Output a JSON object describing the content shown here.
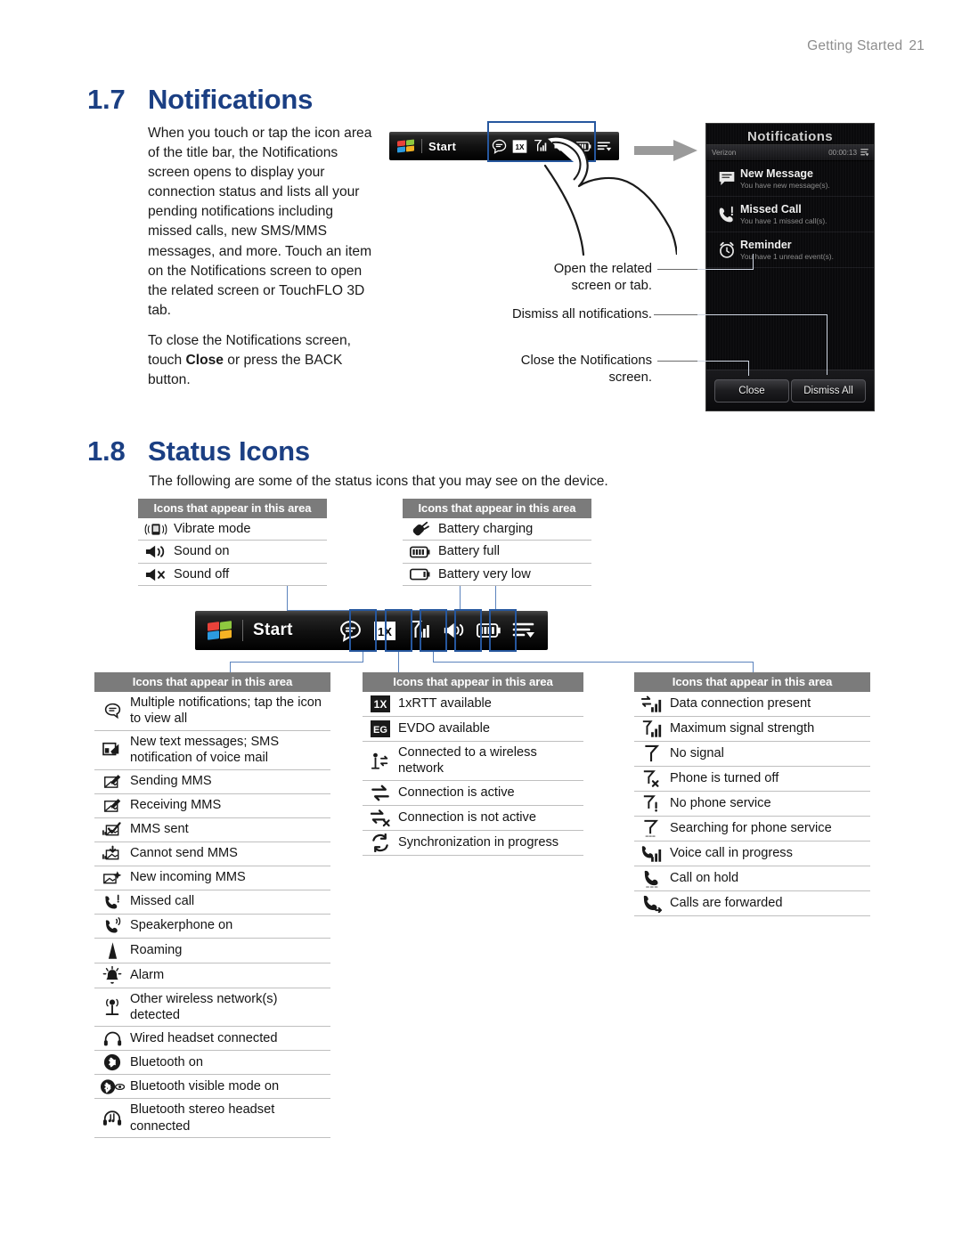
{
  "header": {
    "running_title": "Getting Started",
    "page_number": "21"
  },
  "sections": {
    "notifications": {
      "number": "1.7",
      "title": "Notifications",
      "paragraph_1": "When you touch or tap the icon area of the title bar, the Notifications screen opens to display your connection status and lists all your pending notifications including missed calls, new SMS/MMS messages, and more. Touch an item on the Notifications screen to open the related screen or TouchFLO 3D tab.",
      "paragraph_2_pre": "To close the Notifications screen, touch ",
      "paragraph_2_bold": "Close",
      "paragraph_2_post": " or press the BACK button."
    },
    "status_icons": {
      "number": "1.8",
      "title": "Status Icons",
      "intro": "The following are some of the status icons that you may see on the device."
    }
  },
  "titlebar": {
    "start_label": "Start",
    "icons": [
      "notification-bubble-icon",
      "1x-data-icon",
      "signal-icon",
      "sound-icon",
      "battery-icon",
      "menu-arrow-icon"
    ]
  },
  "callouts": [
    {
      "name": "open-related",
      "line_1": "Open the related",
      "line_2": "screen or tab."
    },
    {
      "name": "dismiss-all",
      "line_1": "Dismiss all notifications.",
      "line_2": ""
    },
    {
      "name": "close-screen",
      "line_1": "Close the Notifications",
      "line_2": "screen."
    }
  ],
  "phone": {
    "screen_title": "Notifications",
    "carrier": "Verizon",
    "timer": "00:00:13",
    "items": [
      {
        "icon": "message-icon",
        "title": "New Message",
        "subtitle": "You have new message(s)."
      },
      {
        "icon": "missed-call-icon",
        "title": "Missed Call",
        "subtitle": "You have 1 missed call(s)."
      },
      {
        "icon": "alarm-clock-icon",
        "title": "Reminder",
        "subtitle": "You have 1 unread event(s)."
      }
    ],
    "buttons": {
      "close": "Close",
      "dismiss_all": "Dismiss All"
    }
  },
  "table_header_label": "Icons that appear in this area",
  "tables": {
    "sound": [
      {
        "icon": "vibrate-icon",
        "label": "Vibrate mode"
      },
      {
        "icon": "sound-on-icon",
        "label": "Sound on"
      },
      {
        "icon": "sound-off-icon",
        "label": "Sound off"
      }
    ],
    "battery": [
      {
        "icon": "battery-charging-icon",
        "label": "Battery charging"
      },
      {
        "icon": "battery-full-icon",
        "label": "Battery full"
      },
      {
        "icon": "battery-low-icon",
        "label": "Battery very low"
      }
    ],
    "messaging": [
      {
        "icon": "notification-bubble-icon",
        "label": "Multiple notifications; tap the icon to view all"
      },
      {
        "icon": "new-sms-icon",
        "label": "New text messages; SMS notification of voice mail"
      },
      {
        "icon": "sending-mms-icon",
        "label": "Sending MMS"
      },
      {
        "icon": "receiving-mms-icon",
        "label": "Receiving MMS"
      },
      {
        "icon": "mms-sent-icon",
        "label": "MMS sent"
      },
      {
        "icon": "mms-failed-icon",
        "label": "Cannot send MMS"
      },
      {
        "icon": "new-mms-icon",
        "label": "New incoming MMS"
      },
      {
        "icon": "missed-call-icon",
        "label": "Missed call"
      },
      {
        "icon": "speakerphone-icon",
        "label": "Speakerphone on"
      },
      {
        "icon": "roaming-icon",
        "label": "Roaming"
      },
      {
        "icon": "alarm-icon",
        "label": "Alarm"
      },
      {
        "icon": "wifi-detected-icon",
        "label": "Other wireless network(s) detected"
      },
      {
        "icon": "wired-headset-icon",
        "label": "Wired headset connected"
      },
      {
        "icon": "bluetooth-on-icon",
        "label": "Bluetooth on"
      },
      {
        "icon": "bluetooth-visible-icon",
        "label": "Bluetooth visible mode on"
      },
      {
        "icon": "bluetooth-stereo-icon",
        "label": "Bluetooth stereo headset connected"
      }
    ],
    "data": [
      {
        "icon": "1xrtt-icon",
        "label": "1xRTT available"
      },
      {
        "icon": "evdo-icon",
        "label": "EVDO available"
      },
      {
        "icon": "wireless-connected-icon",
        "label": "Connected to a wireless network"
      },
      {
        "icon": "connection-active-icon",
        "label": "Connection is active"
      },
      {
        "icon": "connection-inactive-icon",
        "label": "Connection is not active"
      },
      {
        "icon": "sync-icon",
        "label": "Synchronization in progress"
      }
    ],
    "signal": [
      {
        "icon": "data-connection-icon",
        "label": "Data connection present"
      },
      {
        "icon": "max-signal-icon",
        "label": "Maximum signal strength"
      },
      {
        "icon": "no-signal-icon",
        "label": "No signal"
      },
      {
        "icon": "phone-off-icon",
        "label": "Phone is turned off"
      },
      {
        "icon": "no-service-icon",
        "label": "No phone service"
      },
      {
        "icon": "searching-service-icon",
        "label": "Searching for phone service"
      },
      {
        "icon": "voice-call-icon",
        "label": "Voice call in progress"
      },
      {
        "icon": "call-hold-icon",
        "label": "Call on hold"
      },
      {
        "icon": "call-forward-icon",
        "label": "Calls are forwarded"
      }
    ]
  },
  "colors": {
    "heading_blue": "#1b3f83",
    "table_header_gray": "#7b7b7b",
    "highlight_blue": "#26579e",
    "connector_blue": "#5b83bd"
  }
}
